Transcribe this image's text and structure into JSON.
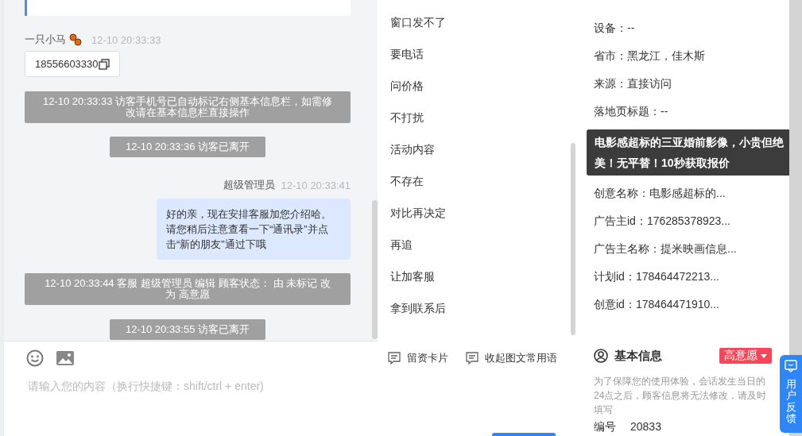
{
  "chat": {
    "messages": [
      {
        "kind": "visitor",
        "sender": "一只小马",
        "time": "12-10 20:33:33",
        "text": "18556603330"
      },
      {
        "kind": "system",
        "text": "12-10 20:33:33 访客手机号已自动标记右侧基本信息栏，如需修改请在基本信息栏直接操作"
      },
      {
        "kind": "system",
        "text": "12-10 20:33:36 访客已离开"
      },
      {
        "kind": "agent",
        "sender": "超级管理员",
        "time": "12-10 20:33:41",
        "text": "好的亲，现在安排客服加您介绍哈。请您稍后注意查看一下“通讯录”并点击“新的朋友”通过下哦"
      },
      {
        "kind": "system",
        "text": "12-10 20:33:44 客服 超级管理员 编辑 顾客状态： 由 未标记 改为 高意愿"
      },
      {
        "kind": "system",
        "text": "12-10 20:33:55 访客已离开"
      }
    ]
  },
  "composer": {
    "actions": [
      "留资卡片",
      "收起图文常用语"
    ],
    "placeholder": "请输入您的内容（换行快捷键：shift/ctrl + enter)"
  },
  "phrases": [
    "窗口发不了",
    "要电话",
    "问价格",
    "不打扰",
    "活动内容",
    "不存在",
    "对比再决定",
    "再追",
    "让加客服",
    "拿到联系后"
  ],
  "source_info": {
    "rows": [
      {
        "kind": "row",
        "text": "设备：--"
      },
      {
        "kind": "row",
        "text": "省市：黑龙江，佳木斯"
      },
      {
        "kind": "row",
        "text": "来源：直接访问"
      },
      {
        "kind": "row",
        "text": "落地页标题：--"
      },
      {
        "kind": "tooltip",
        "text": "电影感超标的三亚婚前影像，小贵但绝美！无平替！10秒获取报价"
      },
      {
        "kind": "row",
        "text": "创意名称：电影感超标的..."
      },
      {
        "kind": "row",
        "text": "广告主id：176285378923..."
      },
      {
        "kind": "row",
        "text": "广告主名称：提米映画信息..."
      },
      {
        "kind": "row",
        "text": "计划id：178464472213..."
      },
      {
        "kind": "row",
        "text": "创意id：178464471910..."
      }
    ]
  },
  "basic_info": {
    "title": "基本信息",
    "status": "高意愿",
    "note": "为了保障您的使用体验，会话发生当日的24点之后，顾客信息将无法修改，请及时填写",
    "rows": [
      {
        "label": "编号",
        "value": "20833"
      }
    ]
  },
  "feedback": {
    "label": "用户反馈"
  }
}
